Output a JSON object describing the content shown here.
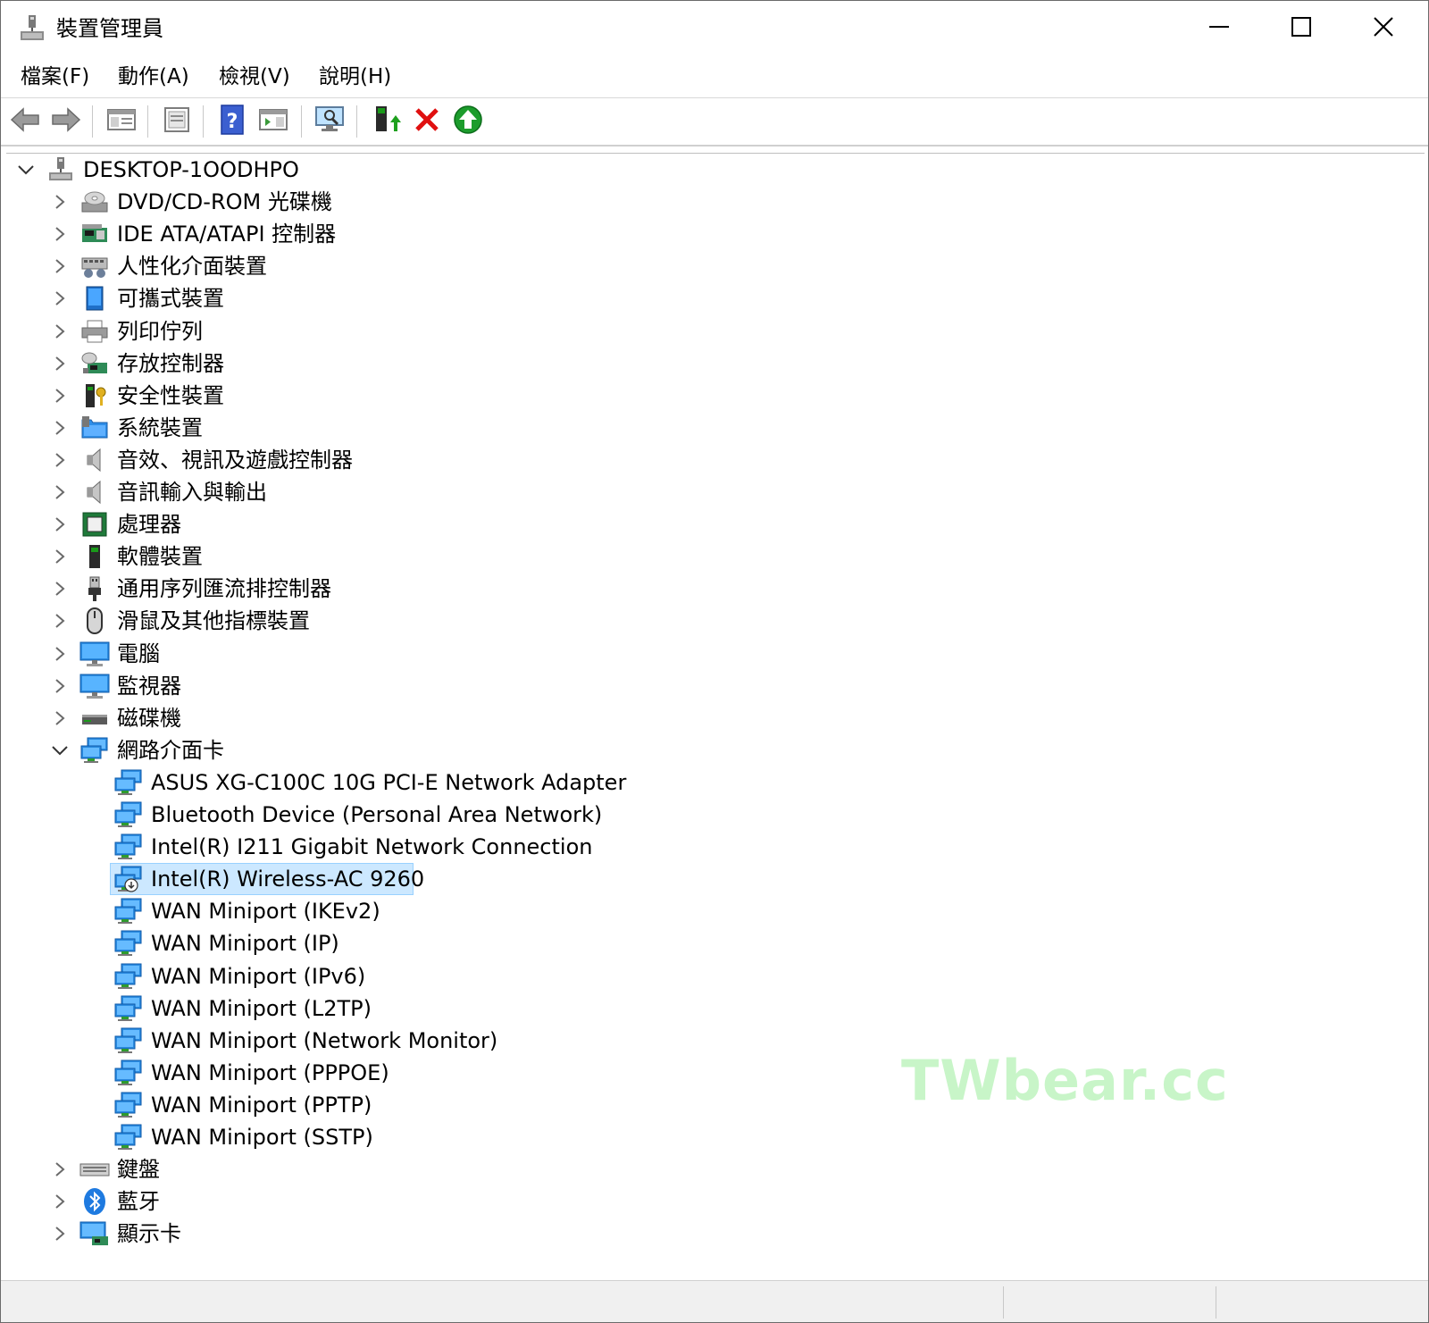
{
  "window": {
    "title": "裝置管理員",
    "icon": "device-manager-icon",
    "controls": [
      "minimize-icon",
      "maximize-icon",
      "close-icon"
    ]
  },
  "menu": {
    "items": [
      {
        "label": "檔案(F)"
      },
      {
        "label": "動作(A)"
      },
      {
        "label": "檢視(V)"
      },
      {
        "label": "說明(H)"
      }
    ]
  },
  "toolbar": {
    "buttons": [
      "back-icon",
      "forward-icon",
      "show-hide-tree-icon",
      "properties-icon",
      "help-icon",
      "action-pane-icon",
      "scan-hardware-icon",
      "update-driver-icon",
      "uninstall-icon",
      "enable-device-icon"
    ]
  },
  "tree": {
    "root": {
      "label": "DESKTOP-1OODHPO",
      "expanded": true
    },
    "categories": [
      {
        "label": "DVD/CD-ROM 光碟機",
        "icon": "dvd-drive-icon"
      },
      {
        "label": "IDE ATA/ATAPI 控制器",
        "icon": "ide-controller-icon"
      },
      {
        "label": "人性化介面裝置",
        "icon": "hid-icon"
      },
      {
        "label": "可攜式裝置",
        "icon": "portable-device-icon"
      },
      {
        "label": "列印佇列",
        "icon": "printer-icon"
      },
      {
        "label": "存放控制器",
        "icon": "storage-controller-icon"
      },
      {
        "label": "安全性裝置",
        "icon": "security-device-icon"
      },
      {
        "label": "系統裝置",
        "icon": "system-folder-icon"
      },
      {
        "label": "音效、視訊及遊戲控制器",
        "icon": "speaker-icon"
      },
      {
        "label": "音訊輸入與輸出",
        "icon": "speaker-icon"
      },
      {
        "label": "處理器",
        "icon": "processor-icon"
      },
      {
        "label": "軟體裝置",
        "icon": "software-device-icon"
      },
      {
        "label": "通用序列匯流排控制器",
        "icon": "usb-icon"
      },
      {
        "label": "滑鼠及其他指標裝置",
        "icon": "mouse-icon"
      },
      {
        "label": "電腦",
        "icon": "computer-monitor-icon"
      },
      {
        "label": "監視器",
        "icon": "monitor-icon"
      },
      {
        "label": "磁碟機",
        "icon": "disk-drive-icon"
      }
    ],
    "network": {
      "label": "網路介面卡",
      "icon": "network-adapter-icon",
      "expanded": true,
      "children": [
        {
          "label": "ASUS XG-C100C 10G PCI-E Network Adapter"
        },
        {
          "label": "Bluetooth Device (Personal Area Network)"
        },
        {
          "label": "Intel(R) I211 Gigabit Network Connection"
        },
        {
          "label": "Intel(R) Wireless-AC 9260",
          "selected": true,
          "disabled": true
        },
        {
          "label": "WAN Miniport (IKEv2)"
        },
        {
          "label": "WAN Miniport (IP)"
        },
        {
          "label": "WAN Miniport (IPv6)"
        },
        {
          "label": "WAN Miniport (L2TP)"
        },
        {
          "label": "WAN Miniport (Network Monitor)"
        },
        {
          "label": "WAN Miniport (PPPOE)"
        },
        {
          "label": "WAN Miniport (PPTP)"
        },
        {
          "label": "WAN Miniport (SSTP)"
        }
      ]
    },
    "after": [
      {
        "label": "鍵盤",
        "icon": "keyboard-icon"
      },
      {
        "label": "藍牙",
        "icon": "bluetooth-icon"
      },
      {
        "label": "顯示卡",
        "icon": "display-adapter-icon"
      }
    ]
  },
  "watermark": "TWbear.cc",
  "colors": {
    "selection_bg": "#cce8ff",
    "selection_border": "#99d1ff",
    "watermark": "#c8f5c8",
    "monitor_blue": "#2b8be0"
  }
}
